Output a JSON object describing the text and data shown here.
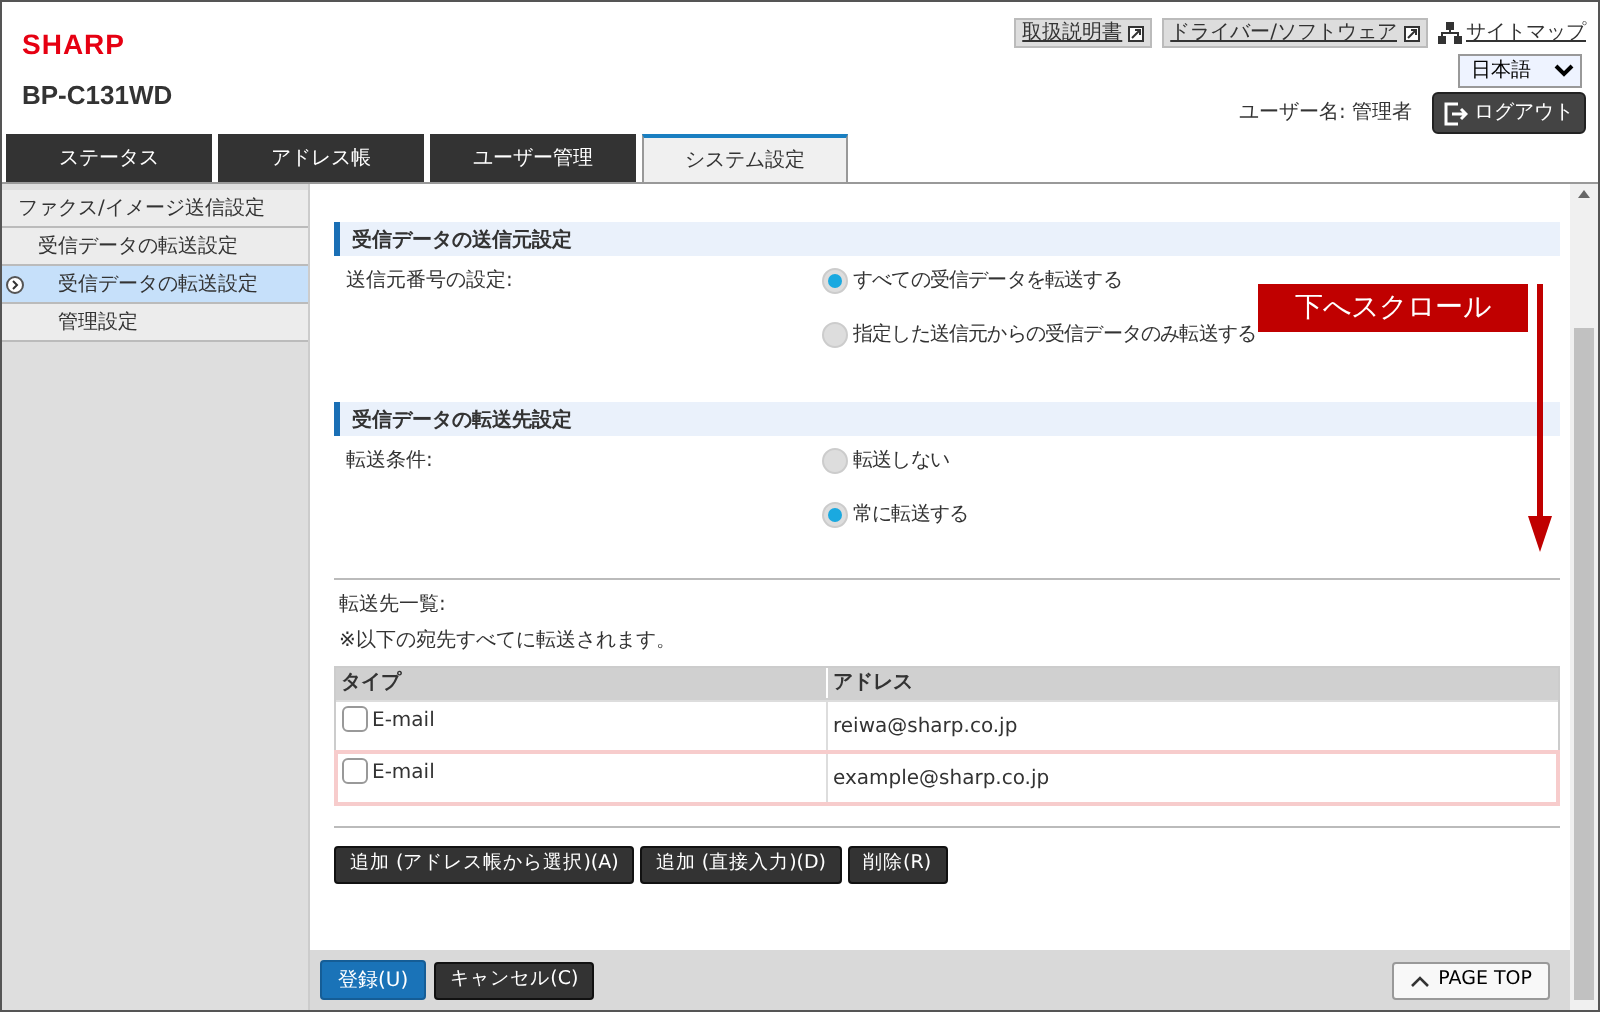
{
  "header": {
    "logo": "SHARP",
    "model": "BP-C131WD",
    "links": [
      {
        "label": "取扱説明書",
        "kind": "external"
      },
      {
        "label": "ドライバー/ソフトウェア",
        "kind": "external"
      },
      {
        "label": "サイトマップ",
        "kind": "sitemap"
      }
    ],
    "language": "日本語",
    "user_label": "ユーザー名: 管理者",
    "logout": "ログアウト"
  },
  "tabs": [
    {
      "label": "ステータス",
      "selected": false
    },
    {
      "label": "アドレス帳",
      "selected": false
    },
    {
      "label": "ユーザー管理",
      "selected": false
    },
    {
      "label": "システム設定",
      "selected": true
    }
  ],
  "sidebar": {
    "items": [
      {
        "label": "ファクス/イメージ送信設定",
        "selected": false,
        "children": [
          {
            "label": "受信データの転送設定",
            "selected": false,
            "children": [
              {
                "label": "受信データの転送設定",
                "selected": true
              },
              {
                "label": "管理設定",
                "selected": false
              }
            ]
          }
        ]
      }
    ]
  },
  "sections": [
    {
      "title": "受信データの送信元設定",
      "label": "送信元番号の設定:",
      "options": [
        {
          "label": "すべての受信データを転送する",
          "selected": true
        },
        {
          "label": "指定した送信元からの受信データのみ転送する",
          "selected": false
        }
      ]
    },
    {
      "title": "受信データの転送先設定",
      "label": "転送条件:",
      "options": [
        {
          "label": "転送しない",
          "selected": false
        },
        {
          "label": "常に転送する",
          "selected": true
        }
      ]
    }
  ],
  "destinations": {
    "label": "転送先一覧:",
    "note": "※以下の宛先すべてに転送されます。",
    "columns": [
      "タイプ",
      "アドレス"
    ],
    "rows": [
      {
        "type": "E-mail",
        "address": "reiwa@sharp.co.jp",
        "checked": false,
        "highlighted": false
      },
      {
        "type": "E-mail",
        "address": "example@sharp.co.jp",
        "checked": false,
        "highlighted": true
      }
    ],
    "buttons": [
      "追加 (アドレス帳から選択)(A)",
      "追加 (直接入力)(D)",
      "削除(R)"
    ]
  },
  "footer": {
    "buttons": [
      {
        "label": "登録(U)",
        "kind": "primary"
      },
      {
        "label": "キャンセル(C)",
        "kind": "secondary"
      }
    ],
    "page_top": "PAGE TOP"
  },
  "annotation": {
    "label": "下へスクロール"
  }
}
